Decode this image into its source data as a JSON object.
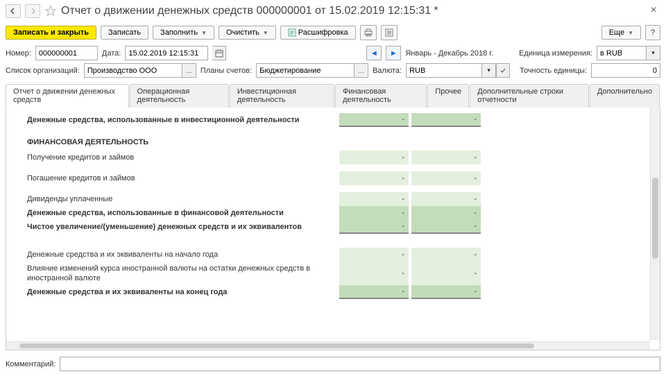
{
  "header": {
    "title": "Отчет о движении денежных средств 000000001 от 15.02.2019 12:15:31 *"
  },
  "toolbar": {
    "write_close": "Записать и закрыть",
    "write": "Записать",
    "fill": "Заполнить",
    "clear": "Очистить",
    "decode": "Расшифровка",
    "more": "Еще"
  },
  "filters": {
    "number_lbl": "Номер:",
    "number": "000000001",
    "date_lbl": "Дата:",
    "date": "15.02.2019 12:15:31",
    "period": "Январь - Декабрь 2018 г.",
    "unit_lbl": "Единица измерения:",
    "unit": "в RUB",
    "orgs_lbl": "Список организаций:",
    "orgs": "Производство ООО",
    "plans_lbl": "Планы счетов:",
    "plans": "Бюджетирование",
    "currency_lbl": "Валюта:",
    "currency": "RUB",
    "precision_lbl": "Точность единицы:",
    "precision": "0"
  },
  "tabs": [
    "Отчет о движении денежных средств",
    "Операционная деятельность",
    "Инвестиционная деятельность",
    "Финансовая деятельность",
    "Прочее",
    "Дополнительные строки отчетности",
    "Дополнительно"
  ],
  "report": {
    "rows": [
      {
        "label": "Денежные средства, использованные в инвестиционной деятельности",
        "bold": true,
        "shade": "dark",
        "v1": "-",
        "v2": "-",
        "border": true
      },
      {
        "spacer": true
      },
      {
        "section": "ФИНАНСОВАЯ ДЕЯТЕЛЬНОСТЬ"
      },
      {
        "label": "Получение кредитов и займов",
        "shade": "light",
        "v1": "-",
        "v2": "-"
      },
      {
        "spacer": true
      },
      {
        "label": "Погашение кредитов и займов",
        "shade": "light",
        "v1": "-",
        "v2": "-"
      },
      {
        "spacer": true
      },
      {
        "label": "Дивиденды уплаченные",
        "shade": "light",
        "v1": "-",
        "v2": "-"
      },
      {
        "label": "Денежные средства, использованные в финансовой деятельности",
        "bold": true,
        "shade": "dark",
        "v1": "-",
        "v2": "-"
      },
      {
        "label": "Чистое увеличение/(уменьшение) денежных средств и их эквивалентов",
        "bold": true,
        "shade": "dark",
        "v1": "-",
        "v2": "-",
        "border": true
      },
      {
        "spacer": true
      },
      {
        "spacer": true
      },
      {
        "label": "Денежные средства и их эквиваленты на начало года",
        "shade": "light",
        "v1": "-",
        "v2": "-"
      },
      {
        "label": "Влияние изменений курса иностранной валюты на остатки денежных средств в иностранной валюте",
        "shade": "light",
        "v1": "-",
        "v2": "-"
      },
      {
        "label": "Денежные средства и их эквиваленты на конец года",
        "bold": true,
        "shade": "dark",
        "v1": "-",
        "v2": "-",
        "border": true
      }
    ]
  },
  "footer": {
    "comment_lbl": "Комментарий:",
    "comment": ""
  }
}
